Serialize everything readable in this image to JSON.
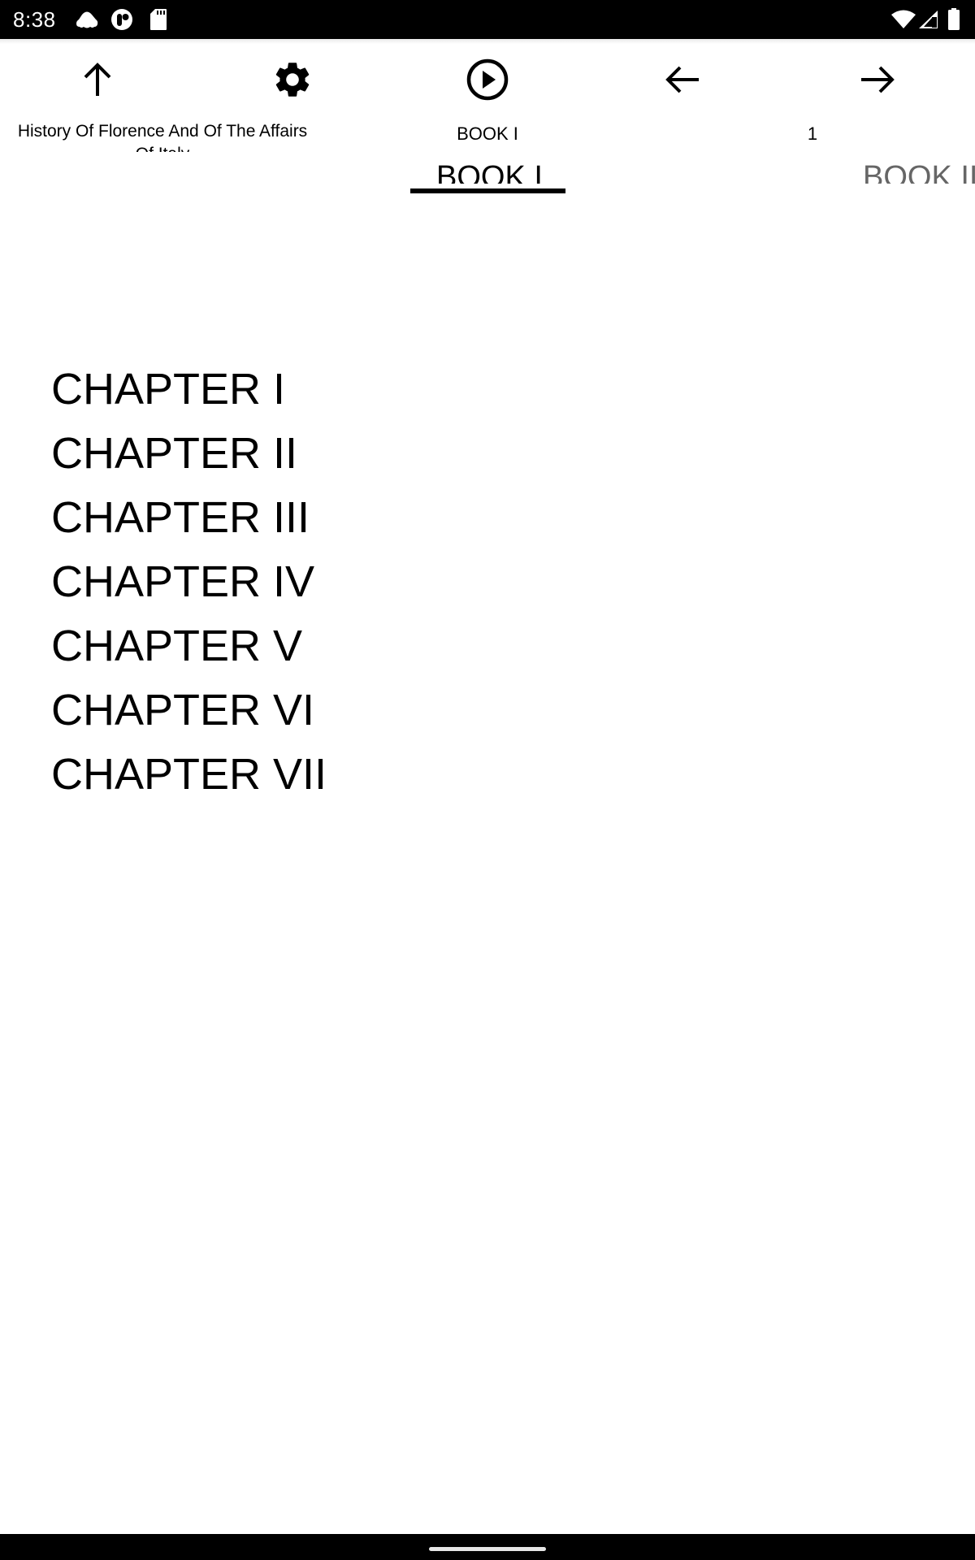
{
  "status_bar": {
    "time": "8:38",
    "left_icons": [
      "cloud-car-icon",
      "app-notification-icon",
      "sd-card-icon"
    ],
    "right_icons": [
      "wifi-icon",
      "cell-signal-icon",
      "battery-icon"
    ]
  },
  "toolbar": {
    "buttons": [
      {
        "name": "up-button",
        "icon": "arrow-up-icon"
      },
      {
        "name": "settings-button",
        "icon": "gear-icon"
      },
      {
        "name": "play-button",
        "icon": "play-circle-icon"
      },
      {
        "name": "previous-button",
        "icon": "arrow-left-icon"
      },
      {
        "name": "next-button",
        "icon": "arrow-right-icon"
      }
    ],
    "book_title": "History Of Florence And Of The Affairs Of Italy",
    "current_section": "BOOK I",
    "page_number": "1"
  },
  "tabs": [
    {
      "label": "BOOK I",
      "active": true
    },
    {
      "label": "BOOK II",
      "active": false
    }
  ],
  "chapters": [
    "CHAPTER I",
    "CHAPTER II",
    "CHAPTER III",
    "CHAPTER IV",
    "CHAPTER V",
    "CHAPTER VI",
    "CHAPTER VII"
  ],
  "colors": {
    "text_primary": "#000000",
    "tab_inactive": "#666666",
    "background": "#ffffff",
    "system_bars": "#000000"
  }
}
